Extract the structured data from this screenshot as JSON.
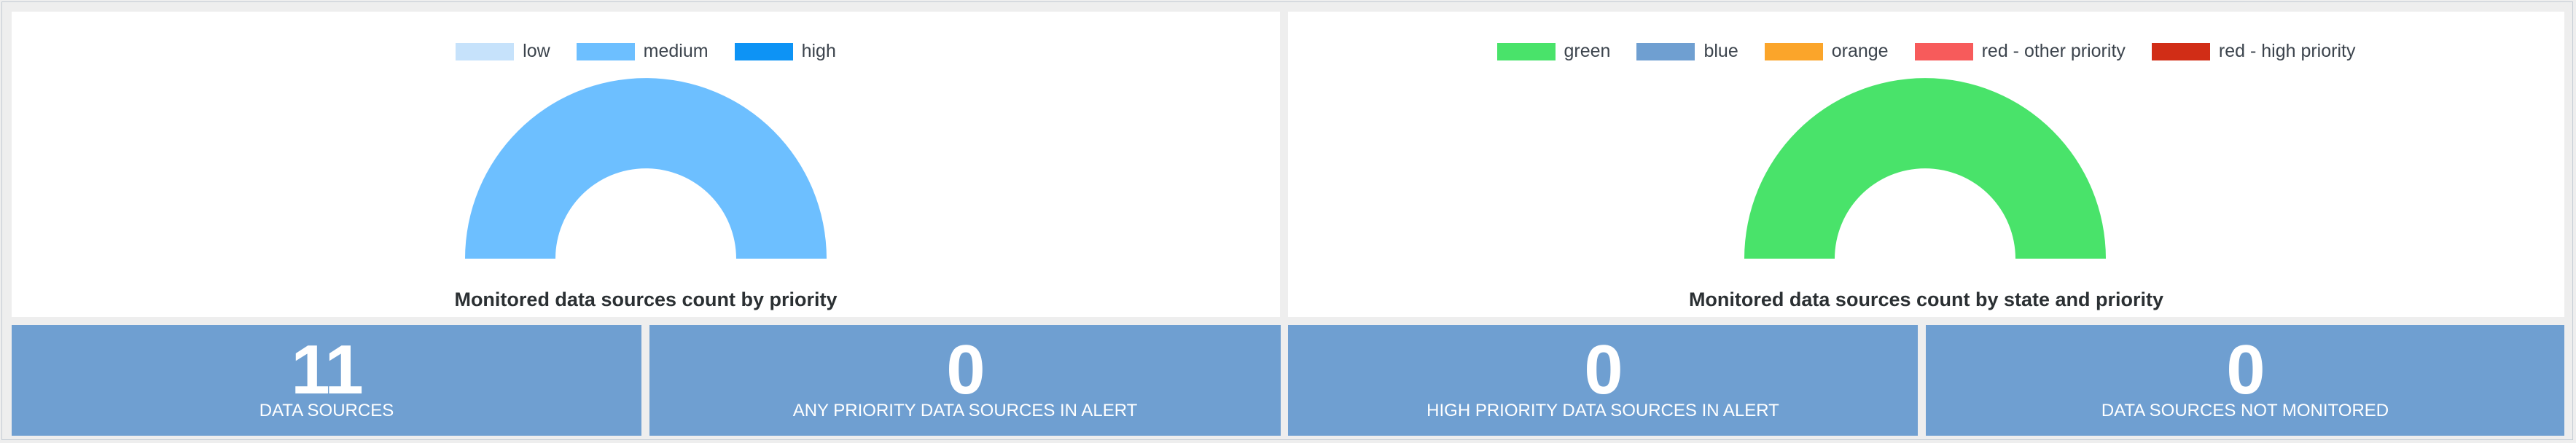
{
  "panels": [
    {
      "title": "Monitored data sources count by priority",
      "legend": [
        {
          "label": "low",
          "color": "#c6e2fb"
        },
        {
          "label": "medium",
          "color": "#6dbfff"
        },
        {
          "label": "high",
          "color": "#0d93f5"
        }
      ],
      "gauge_color": "#6dbfff"
    },
    {
      "title": "Monitored data sources count by state and priority",
      "legend": [
        {
          "label": "green",
          "color": "#49e36a"
        },
        {
          "label": "blue",
          "color": "#6f9fd1"
        },
        {
          "label": "orange",
          "color": "#fba52a"
        },
        {
          "label": "red - other priority",
          "color": "#f75b5b"
        },
        {
          "label": "red - high priority",
          "color": "#d12d16"
        }
      ],
      "gauge_color": "#49e36a"
    }
  ],
  "tiles": [
    {
      "value": "11",
      "label": "DATA SOURCES"
    },
    {
      "value": "0",
      "label": "ANY PRIORITY DATA SOURCES IN ALERT"
    },
    {
      "value": "0",
      "label": "HIGH PRIORITY DATA SOURCES IN ALERT"
    },
    {
      "value": "0",
      "label": "DATA SOURCES NOT MONITORED"
    }
  ],
  "colors": {
    "tile_background": "#6f9fd1",
    "panel_background": "#ffffff",
    "page_background": "#eeeeee"
  }
}
